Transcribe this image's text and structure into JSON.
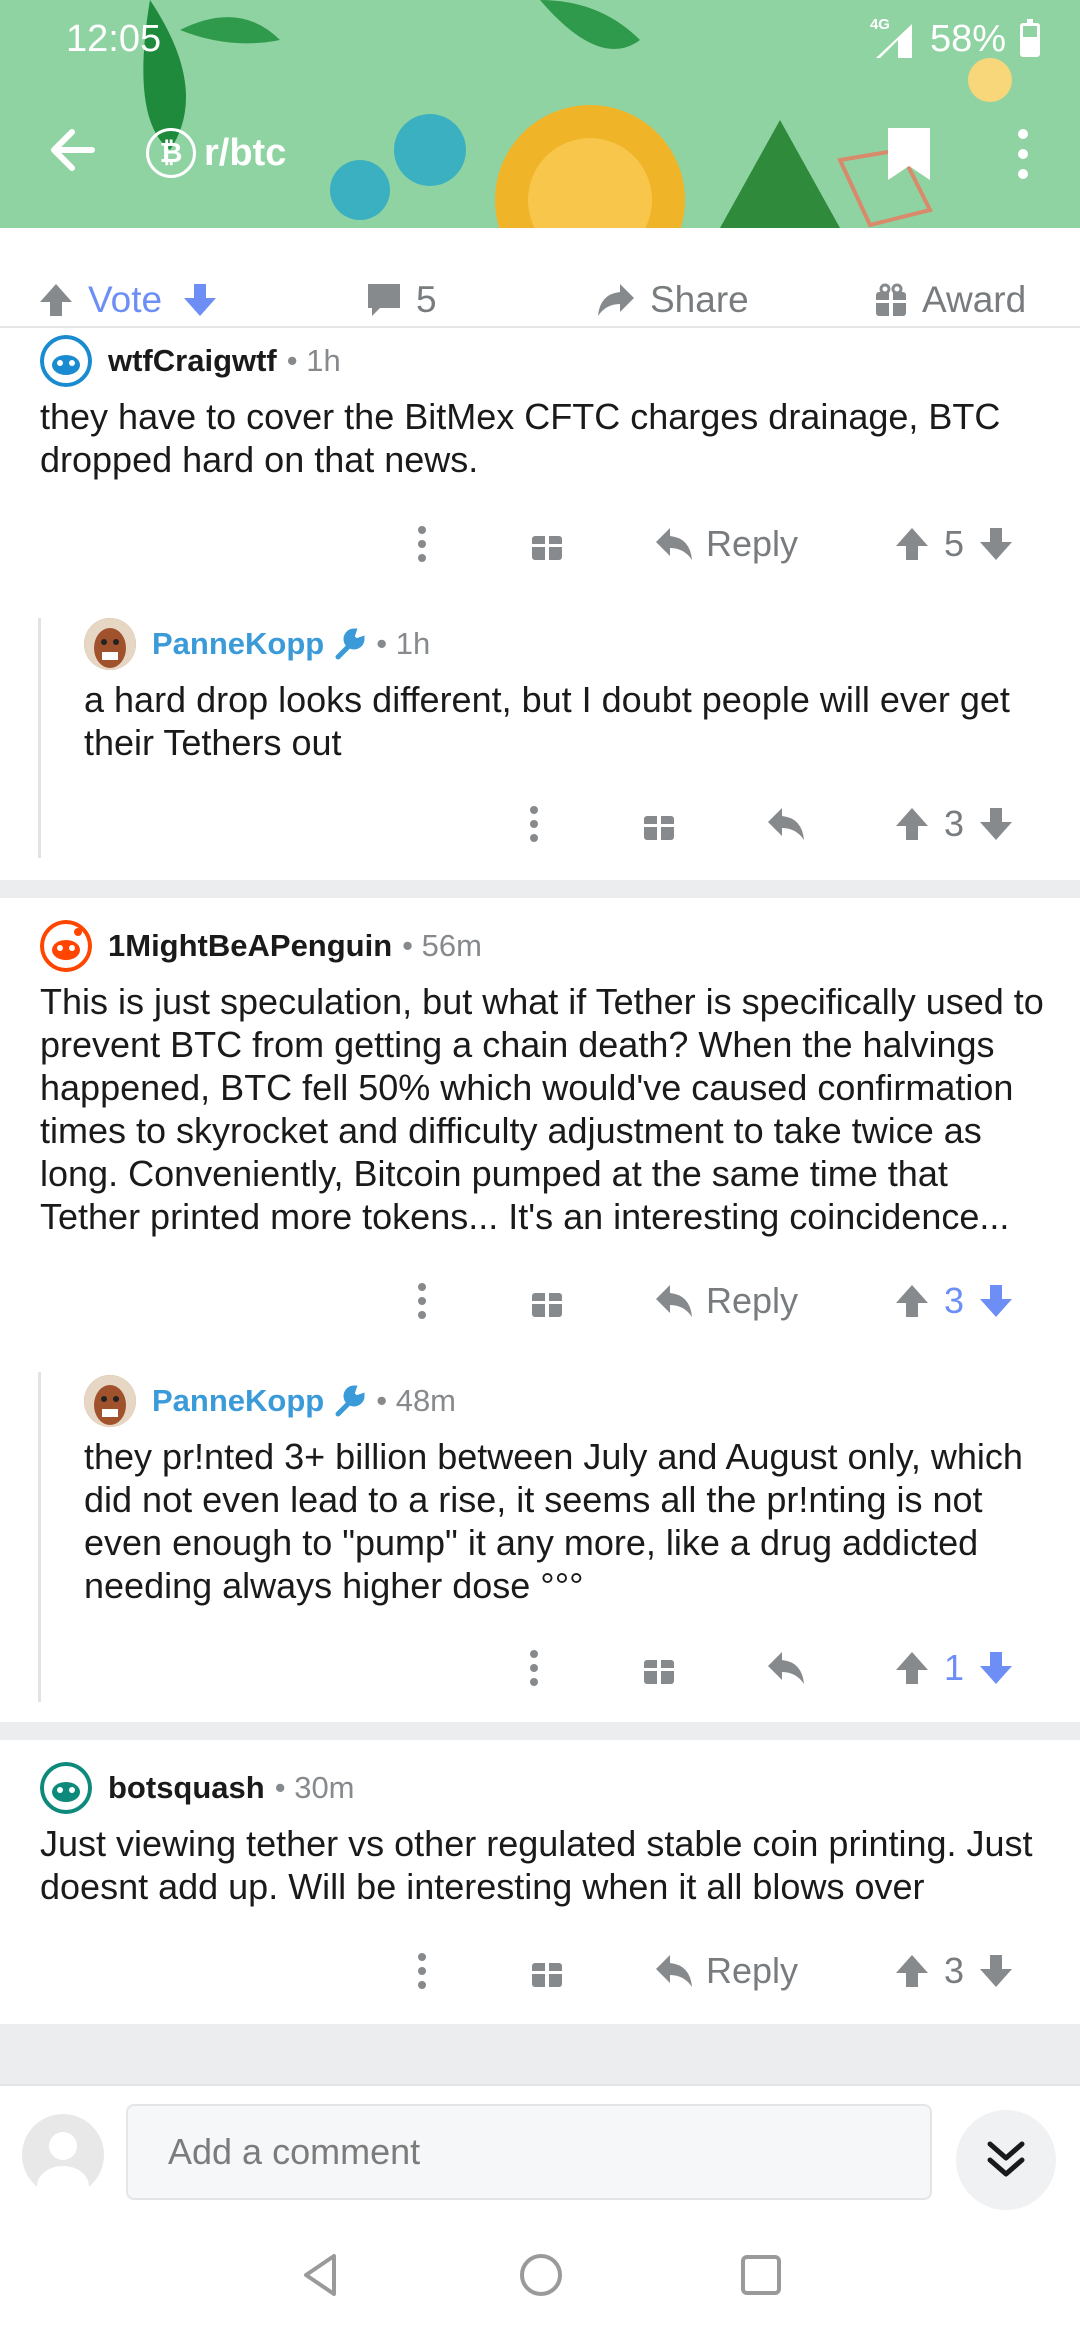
{
  "status_bar": {
    "time": "12:05",
    "network": "4G",
    "battery": "58%"
  },
  "toolbar": {
    "subreddit": "r/btc",
    "sub_icon": "₿"
  },
  "post_actions": {
    "vote_label": "Vote",
    "comments_count": "5",
    "share_label": "Share",
    "award_label": "Award"
  },
  "comments": [
    {
      "author": "wtfCraigwtf",
      "time": "1h",
      "body": "they have to cover the BitMex CFTC charges drainage, BTC dropped hard on that news.",
      "reply_label": "Reply",
      "score": "5"
    },
    {
      "author": "PanneKopp",
      "time": "1h",
      "body": "a hard drop looks different, but I doubt people will ever get their Tethers out",
      "score": "3"
    },
    {
      "author": "1MightBeAPenguin",
      "time": "56m",
      "body": "This is just speculation, but what if Tether is specifically used to prevent BTC from getting a chain death? When the halvings happened, BTC fell 50% which would've caused confirmation times to skyrocket and difficulty adjustment to take twice as long. Conveniently, Bitcoin pumped at the same time that Tether printed more tokens... It's an interesting coincidence...",
      "reply_label": "Reply",
      "score": "3"
    },
    {
      "author": "PanneKopp",
      "time": "48m",
      "body": "they pr!nted 3+ billion between July and August only, which did not even lead to a rise, it seems all the pr!nting is not even enough to \"pump\" it any more, like a drug addicted needing always higher dose °°°",
      "score": "1"
    },
    {
      "author": "botsquash",
      "time": "30m",
      "body": "Just viewing tether vs other regulated stable coin printing. Just doesnt add up. Will be interesting when it all blows over",
      "reply_label": "Reply",
      "score": "3"
    }
  ],
  "compose": {
    "placeholder": "Add a comment"
  },
  "colors": {
    "header_bg": "#8fd3a2",
    "upvote_active": "#6c8ef5",
    "mod_name": "#3b9bd9"
  }
}
